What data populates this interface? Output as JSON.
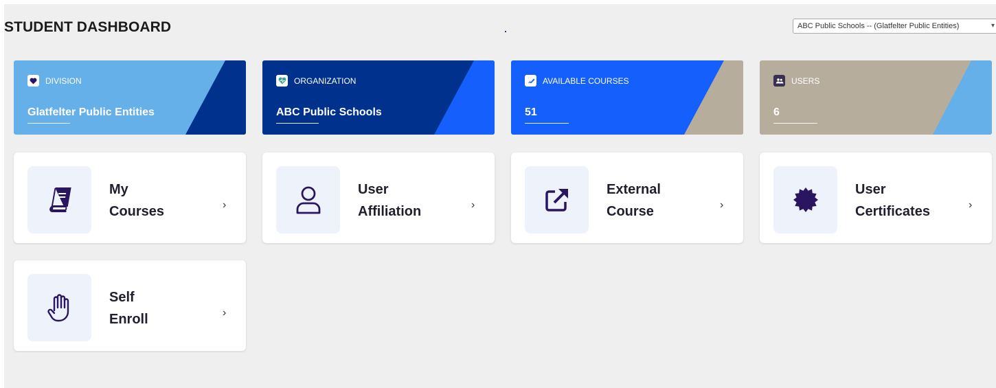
{
  "header": {
    "title": "STUDENT DASHBOARD",
    "org_select": {
      "selected": "ABC Public Schools -- (Glatfelter Public Entities)"
    }
  },
  "stats": [
    {
      "label": "DIVISION",
      "value": "Glatfelter Public Entities",
      "icon": "heart-icon"
    },
    {
      "label": "ORGANIZATION",
      "value": "ABC Public Schools",
      "icon": "heartbeat-icon"
    },
    {
      "label": "AVAILABLE COURSES",
      "value": "51",
      "icon": "eraser-icon"
    },
    {
      "label": "USERS",
      "value": "6",
      "icon": "users-icon"
    }
  ],
  "tiles": [
    {
      "line1": "My",
      "line2": "Courses",
      "icon": "book-icon"
    },
    {
      "line1": "User",
      "line2": "Affiliation",
      "icon": "user-icon"
    },
    {
      "line1": "External",
      "line2": "Course",
      "icon": "external-link-icon"
    },
    {
      "line1": "User",
      "line2": "Certificates",
      "icon": "certificate-badge-icon"
    },
    {
      "line1": "Self",
      "line2": "Enroll",
      "icon": "hand-icon"
    }
  ],
  "colors": {
    "light_blue": "#65b0e8",
    "navy": "#00318c",
    "bright_blue": "#1560fd",
    "taupe": "#b7ad9d",
    "icon_purple": "#2a1660",
    "background": "#efefef"
  }
}
